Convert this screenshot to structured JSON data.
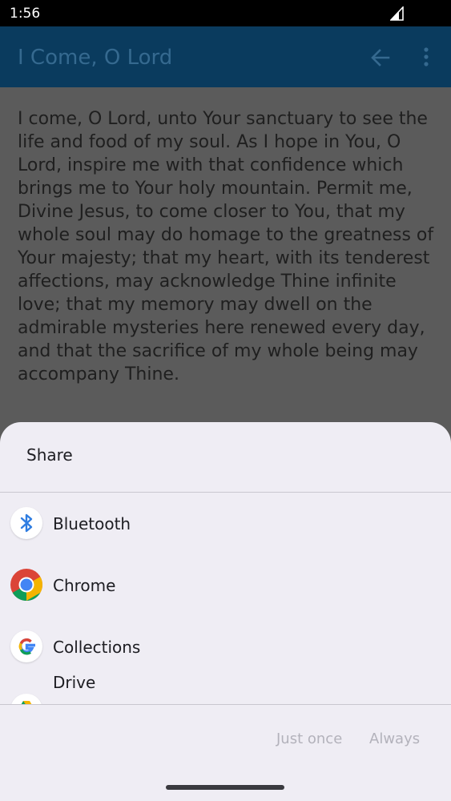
{
  "status_bar": {
    "time": "1:56"
  },
  "app_bar": {
    "title": "I Come, O Lord"
  },
  "content": {
    "prayer_text": "I come, O Lord, unto Your sanctuary to see the life and food of my soul. As I hope in You, O Lord, inspire me with that confidence which brings me to Your holy mountain. Permit me, Divine Jesus, to come closer to You, that my whole soul may do homage to the greatness of Your majesty; that my heart, with its tenderest affections, may acknowledge Thine infinite love; that my memory may dwell on the admirable mysteries here renewed every day, and that the sacrifice of my whole being may accompany Thine."
  },
  "share_sheet": {
    "title": "Share",
    "apps": [
      {
        "label": "Bluetooth",
        "icon": "bluetooth-icon"
      },
      {
        "label": "Chrome",
        "icon": "chrome-icon"
      },
      {
        "label": "Collections",
        "icon": "google-icon"
      },
      {
        "label": "Drive",
        "icon": "drive-icon"
      }
    ],
    "buttons": {
      "just_once": "Just once",
      "always": "Always"
    }
  }
}
